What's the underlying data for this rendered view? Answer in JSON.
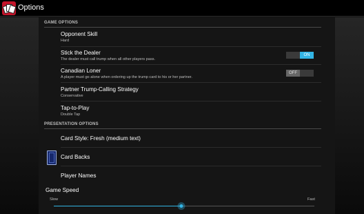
{
  "app": {
    "title": "Options"
  },
  "sections": {
    "game_options": "GAME OPTIONS",
    "presentation_options": "PRESENTATION OPTIONS"
  },
  "prefs": {
    "opponent_skill": {
      "title": "Opponent Skill",
      "summary": "Hard"
    },
    "stick_dealer": {
      "title": "Stick the Dealer",
      "summary": "The dealer must call trump when all other players pass.",
      "toggle": "ON"
    },
    "canadian_loner": {
      "title": "Canadian Loner",
      "summary": "A player must go alone when ordering up the trump card to his or her partner.",
      "toggle": "OFF"
    },
    "partner_strategy": {
      "title": "Partner Trump-Calling Strategy",
      "summary": "Conservative"
    },
    "tap_to_play": {
      "title": "Tap-to-Play",
      "summary": "Double Tap"
    },
    "card_style": {
      "title": "Card Style: Fresh (medium text)"
    },
    "card_backs": {
      "title": "Card Backs"
    },
    "player_names": {
      "title": "Player Names"
    },
    "game_speed": {
      "title": "Game Speed",
      "min_label": "Slow",
      "max_label": "Fast",
      "value_fraction": 0.49
    }
  },
  "colors": {
    "accent": "#33b5e5",
    "app_icon": "#c4142a"
  },
  "icons": {
    "app": "card-hand-icon",
    "card_back": "card-back-icon"
  }
}
